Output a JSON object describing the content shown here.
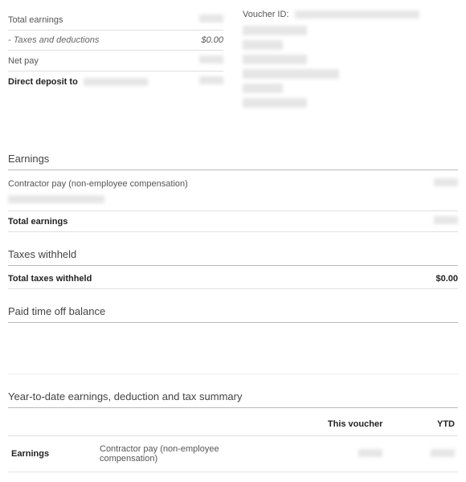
{
  "summary": {
    "total_earnings_label": "Total earnings",
    "taxes_deductions_label": "- Taxes and deductions",
    "taxes_deductions_value": "$0.00",
    "net_pay_label": "Net pay",
    "direct_deposit_label": "Direct deposit to"
  },
  "voucher": {
    "label": "Voucher ID:"
  },
  "earnings": {
    "title": "Earnings",
    "contractor_label": "Contractor pay (non-employee compensation)",
    "total_label": "Total earnings"
  },
  "taxes": {
    "title": "Taxes withheld",
    "total_label": "Total taxes withheld",
    "total_value": "$0.00"
  },
  "pto": {
    "title": "Paid time off balance"
  },
  "ytd": {
    "title": "Year-to-date earnings, deduction and tax summary",
    "col_this": "This voucher",
    "col_ytd": "YTD",
    "row_earnings_label": "Earnings",
    "row_earnings_desc": "Contractor pay (non-employee compensation)"
  }
}
